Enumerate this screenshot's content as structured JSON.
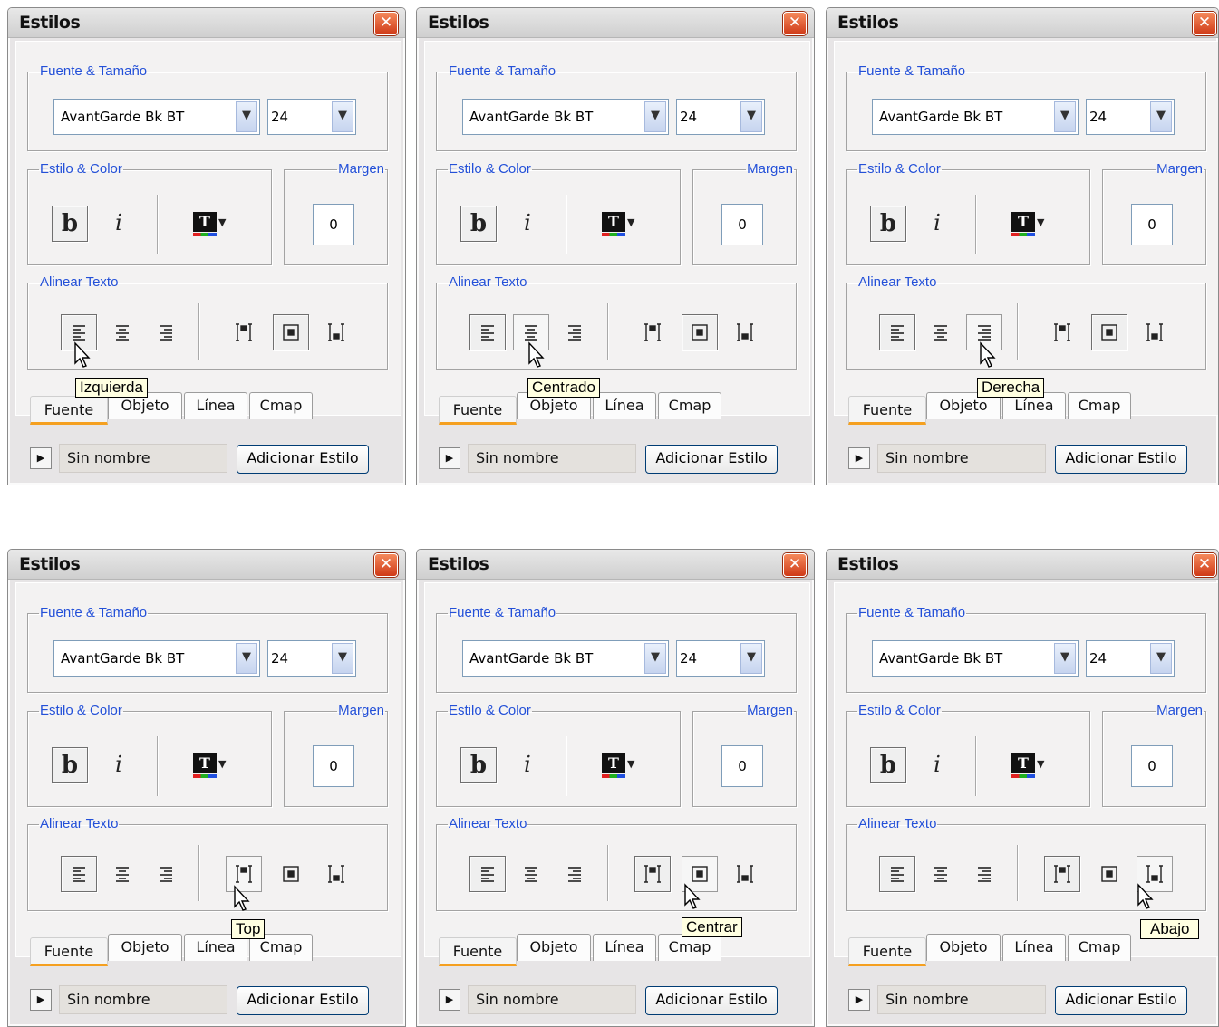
{
  "common": {
    "title": "Estilos",
    "close_symbol": "✕",
    "font_group_label": "Fuente & Tamaño",
    "font_name": "AvantGarde Bk BT",
    "font_size": "24",
    "style_group_label": "Estilo & Color",
    "bold_label": "b",
    "italic_label": "i",
    "color_button_letter": "T",
    "margin_group_label": "Margen",
    "margin_value": "0",
    "align_group_label": "Alinear Texto",
    "tabs": [
      "Fuente",
      "Objeto",
      "Línea",
      "Cmap"
    ],
    "style_name": "Sin nombre",
    "add_style_label": "Adicionar Estilo",
    "icons": {
      "close": "close-icon",
      "dropdown": "chevron-down-icon",
      "color": "text-color-icon",
      "play": "play-icon",
      "align_left": "align-left-icon",
      "align_center": "align-center-icon",
      "align_right": "align-right-icon",
      "valign_top": "valign-top-icon",
      "valign_middle": "valign-middle-icon",
      "valign_bottom": "valign-bottom-icon",
      "cursor": "mouse-pointer-icon"
    },
    "colors": {
      "legend_text": "#2350d8",
      "active_tab_underline": "#f5a020",
      "tooltip_bg": "#ffffe1",
      "close_button": "#e0552b"
    }
  },
  "panels": [
    {
      "tooltip": "Izquierda",
      "hovered": "align_left"
    },
    {
      "tooltip": "Centrado",
      "hovered": "align_center"
    },
    {
      "tooltip": "Derecha",
      "hovered": "align_right"
    },
    {
      "tooltip": "Top",
      "hovered": "valign_top"
    },
    {
      "tooltip": "Centrar",
      "hovered": "valign_middle"
    },
    {
      "tooltip": "Abajo",
      "hovered": "valign_bottom"
    }
  ]
}
